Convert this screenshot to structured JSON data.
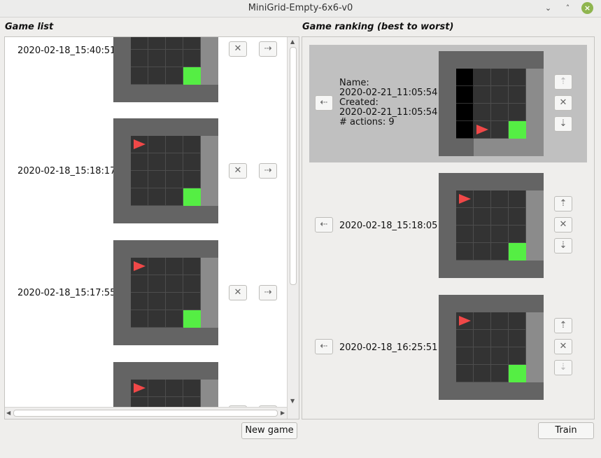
{
  "window": {
    "title": "MiniGrid-Empty-6x6-v0",
    "minimize_glyph": "⌄",
    "maximize_glyph": "˄",
    "close_glyph": "×"
  },
  "game_list": {
    "title": "Game list",
    "items": [
      {
        "timestamp": "2020-02-18_15:40:51"
      },
      {
        "timestamp": "2020-02-18_15:18:17"
      },
      {
        "timestamp": "2020-02-18_15:17:55"
      },
      {
        "timestamp": ""
      }
    ],
    "delete_glyph": "✕",
    "move_right_glyph": "⇢",
    "scroll_up_glyph": "▲",
    "scroll_down_glyph": "▼",
    "scroll_left_glyph": "◀",
    "scroll_right_glyph": "▶"
  },
  "ranking": {
    "title": "Game ranking (best to worst)",
    "selected": {
      "name_label": "Name:",
      "name": "2020-02-21_11:05:54",
      "created_label": "Created:",
      "created": "2020-02-21_11:05:54",
      "actions_label": "# actions: 9"
    },
    "items": [
      {
        "timestamp": "2020-02-18_15:18:05"
      },
      {
        "timestamp": "2020-02-18_16:25:51"
      }
    ],
    "move_left_glyph": "⇠",
    "up_glyph": "⇡",
    "delete_glyph": "✕",
    "down_glyph": "⇣"
  },
  "buttons": {
    "new_game": "New game",
    "train": "Train"
  },
  "colors": {
    "goal": "#55ee44",
    "agent": "#f04848",
    "wall": "#646464",
    "floor": "#333333",
    "visible_wall": "#8b8b8b",
    "unseen": "#000000",
    "selected_row": "#c0c0c0",
    "close_button": "#8fb54f"
  },
  "icons": [
    "minimize-icon",
    "maximize-icon",
    "close-icon",
    "delete-icon",
    "arrow-right-icon",
    "arrow-left-icon",
    "arrow-up-icon",
    "arrow-down-icon"
  ]
}
